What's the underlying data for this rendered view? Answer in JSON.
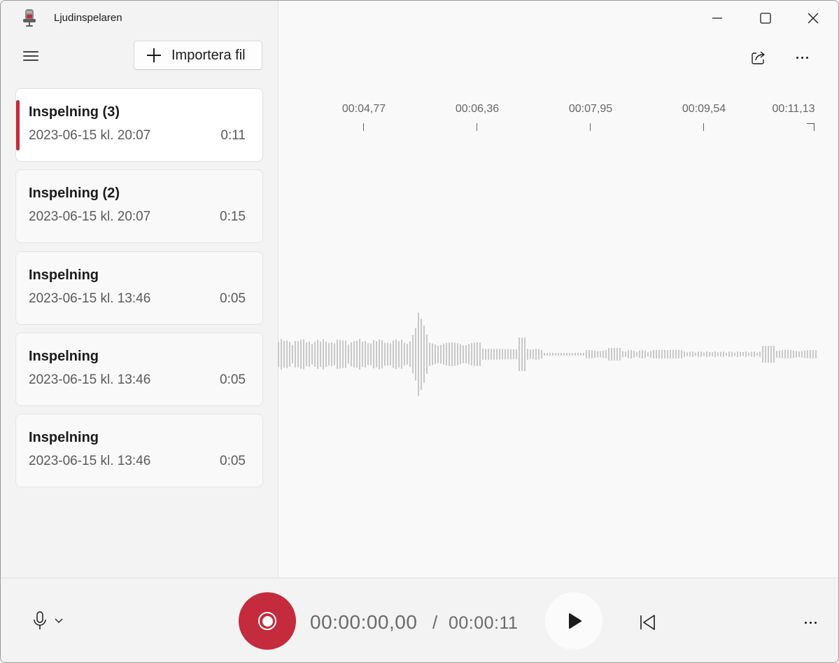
{
  "app": {
    "title": "Ljudinspelaren",
    "accent_color": "#c42b3c"
  },
  "toolbar": {
    "import_label": "Importera fil"
  },
  "recordings": [
    {
      "name": "Inspelning (3)",
      "date": "2023-06-15 kl. 20:07",
      "duration": "0:11",
      "selected": true
    },
    {
      "name": "Inspelning (2)",
      "date": "2023-06-15 kl. 20:07",
      "duration": "0:15",
      "selected": false
    },
    {
      "name": "Inspelning",
      "date": "2023-06-15 kl. 13:46",
      "duration": "0:05",
      "selected": false
    },
    {
      "name": "Inspelning",
      "date": "2023-06-15 kl. 13:46",
      "duration": "0:05",
      "selected": false
    },
    {
      "name": "Inspelning",
      "date": "2023-06-15 kl. 13:46",
      "duration": "0:05",
      "selected": false
    }
  ],
  "timeline": {
    "ticks": [
      "00:04,77",
      "00:06,36",
      "00:07,95",
      "00:09,54",
      "00:11,13"
    ]
  },
  "player": {
    "current_time": "00:00:00,00",
    "separator": "/",
    "total_time": "00:00:11"
  },
  "icons": {
    "app": "microphone-app-icon",
    "menu": "hamburger-icon",
    "import": "plus-icon",
    "share": "share-icon",
    "more": "more-icon",
    "mic": "microphone-icon",
    "record": "record-icon",
    "play": "play-icon",
    "rewind": "skip-back-icon"
  }
}
